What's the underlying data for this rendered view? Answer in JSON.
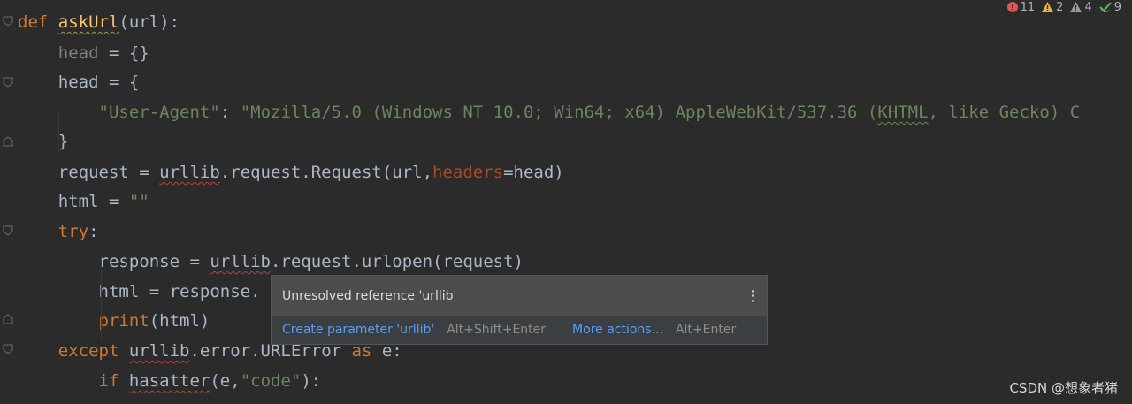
{
  "editor": {
    "lines": [
      {
        "tokens": [
          {
            "t": "def ",
            "c": "kw"
          },
          {
            "t": "askUrl",
            "c": "fn squig-y"
          },
          {
            "t": "(url):",
            "c": ""
          }
        ]
      },
      {
        "tokens": [
          {
            "t": "    ",
            "c": ""
          },
          {
            "t": "head",
            "c": "dim"
          },
          {
            "t": " = {}",
            "c": ""
          }
        ]
      },
      {
        "tokens": [
          {
            "t": "    head = {",
            "c": ""
          }
        ]
      },
      {
        "tokens": [
          {
            "t": "        ",
            "c": ""
          },
          {
            "t": "\"User-Agent\"",
            "c": "str"
          },
          {
            "t": ": ",
            "c": ""
          },
          {
            "t": "\"Mozilla/5.0 (Windows NT 10.0; Win64; x64) AppleWebKit/537.36 (",
            "c": "str"
          },
          {
            "t": "KHTML",
            "c": "str squig-g"
          },
          {
            "t": ", like Gecko) C",
            "c": "str"
          }
        ]
      },
      {
        "tokens": [
          {
            "t": "    }",
            "c": ""
          }
        ]
      },
      {
        "tokens": [
          {
            "t": "    request = ",
            "c": ""
          },
          {
            "t": "urllib",
            "c": "squig"
          },
          {
            "t": ".request.Request(url,",
            "c": ""
          },
          {
            "t": "headers",
            "c": "param"
          },
          {
            "t": "=head)",
            "c": ""
          }
        ]
      },
      {
        "tokens": [
          {
            "t": "    html = ",
            "c": ""
          },
          {
            "t": "\"\"",
            "c": "str"
          }
        ]
      },
      {
        "tokens": [
          {
            "t": "    ",
            "c": ""
          },
          {
            "t": "try",
            "c": "kw"
          },
          {
            "t": ":",
            "c": ""
          }
        ]
      },
      {
        "tokens": [
          {
            "t": "        response = ",
            "c": ""
          },
          {
            "t": "urllib",
            "c": "squig"
          },
          {
            "t": ".request.urlopen(request)",
            "c": ""
          }
        ]
      },
      {
        "tokens": [
          {
            "t": "        html = response.",
            "c": ""
          }
        ]
      },
      {
        "tokens": [
          {
            "t": "        ",
            "c": ""
          },
          {
            "t": "print",
            "c": "kw"
          },
          {
            "t": "(html)",
            "c": ""
          }
        ]
      },
      {
        "tokens": [
          {
            "t": "    ",
            "c": ""
          },
          {
            "t": "except ",
            "c": "kw"
          },
          {
            "t": "urllib",
            "c": "squig"
          },
          {
            "t": ".error.URLError ",
            "c": ""
          },
          {
            "t": "as ",
            "c": "kw"
          },
          {
            "t": "e:",
            "c": ""
          }
        ]
      },
      {
        "tokens": [
          {
            "t": "        ",
            "c": ""
          },
          {
            "t": "if ",
            "c": "kw"
          },
          {
            "t": "hasatter",
            "c": "squig"
          },
          {
            "t": "(e,",
            "c": ""
          },
          {
            "t": "\"code\"",
            "c": "str"
          },
          {
            "t": "):",
            "c": ""
          }
        ]
      }
    ]
  },
  "inspections": {
    "errors": "11",
    "warnings": "2",
    "weak_warnings": "4",
    "typos": "9",
    "colors": {
      "error": "#e05555",
      "warning": "#e3b341",
      "weak": "#9a9a9a",
      "ok": "#5fb760"
    }
  },
  "popup": {
    "title": "Unresolved reference 'urllib'",
    "action_label": "Create parameter 'urllib'",
    "action_shortcut": "Alt+Shift+Enter",
    "more_label": "More actions...",
    "more_shortcut": "Alt+Enter"
  },
  "watermark": "CSDN @想象者猪"
}
